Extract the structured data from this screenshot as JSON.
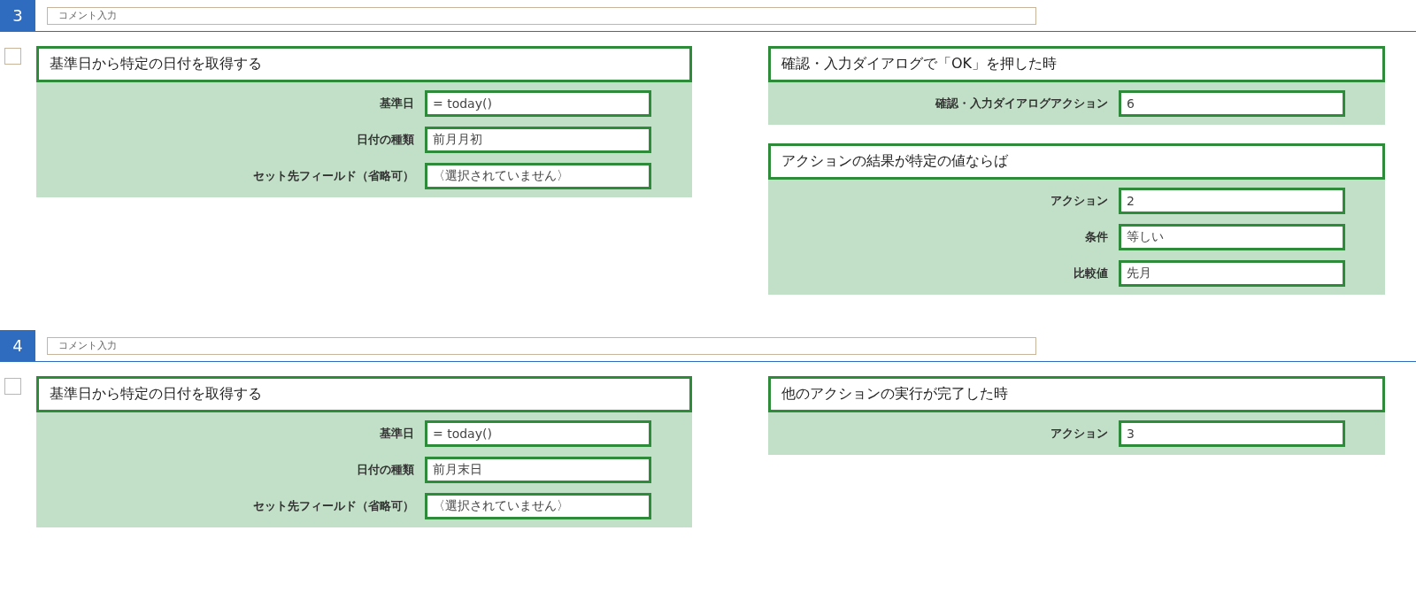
{
  "sections": [
    {
      "number": "3",
      "comment_placeholder": "コメント入力",
      "checked": false,
      "left": [
        {
          "title": "基準日から特定の日付を取得する",
          "fields": [
            {
              "label": "基準日",
              "value": "= today()"
            },
            {
              "label": "日付の種類",
              "value": "前月月初"
            },
            {
              "label": "セット先フィールド（省略可）",
              "value": "〈選択されていません〉"
            }
          ]
        }
      ],
      "right": [
        {
          "title": "確認・入力ダイアログで「OK」を押した時",
          "fields": [
            {
              "label": "確認・入力ダイアログアクション",
              "value": "6"
            }
          ]
        },
        {
          "title": "アクションの結果が特定の値ならば",
          "fields": [
            {
              "label": "アクション",
              "value": "2"
            },
            {
              "label": "条件",
              "value": "等しい"
            },
            {
              "label": "比較値",
              "value": "先月"
            }
          ]
        }
      ]
    },
    {
      "number": "4",
      "comment_placeholder": "コメント入力",
      "checked": false,
      "left": [
        {
          "title": "基準日から特定の日付を取得する",
          "fields": [
            {
              "label": "基準日",
              "value": "= today()"
            },
            {
              "label": "日付の種類",
              "value": "前月末日"
            },
            {
              "label": "セット先フィールド（省略可）",
              "value": "〈選択されていません〉"
            }
          ]
        }
      ],
      "right": [
        {
          "title": "他のアクションの実行が完了した時",
          "fields": [
            {
              "label": "アクション",
              "value": "3"
            }
          ]
        }
      ]
    }
  ]
}
